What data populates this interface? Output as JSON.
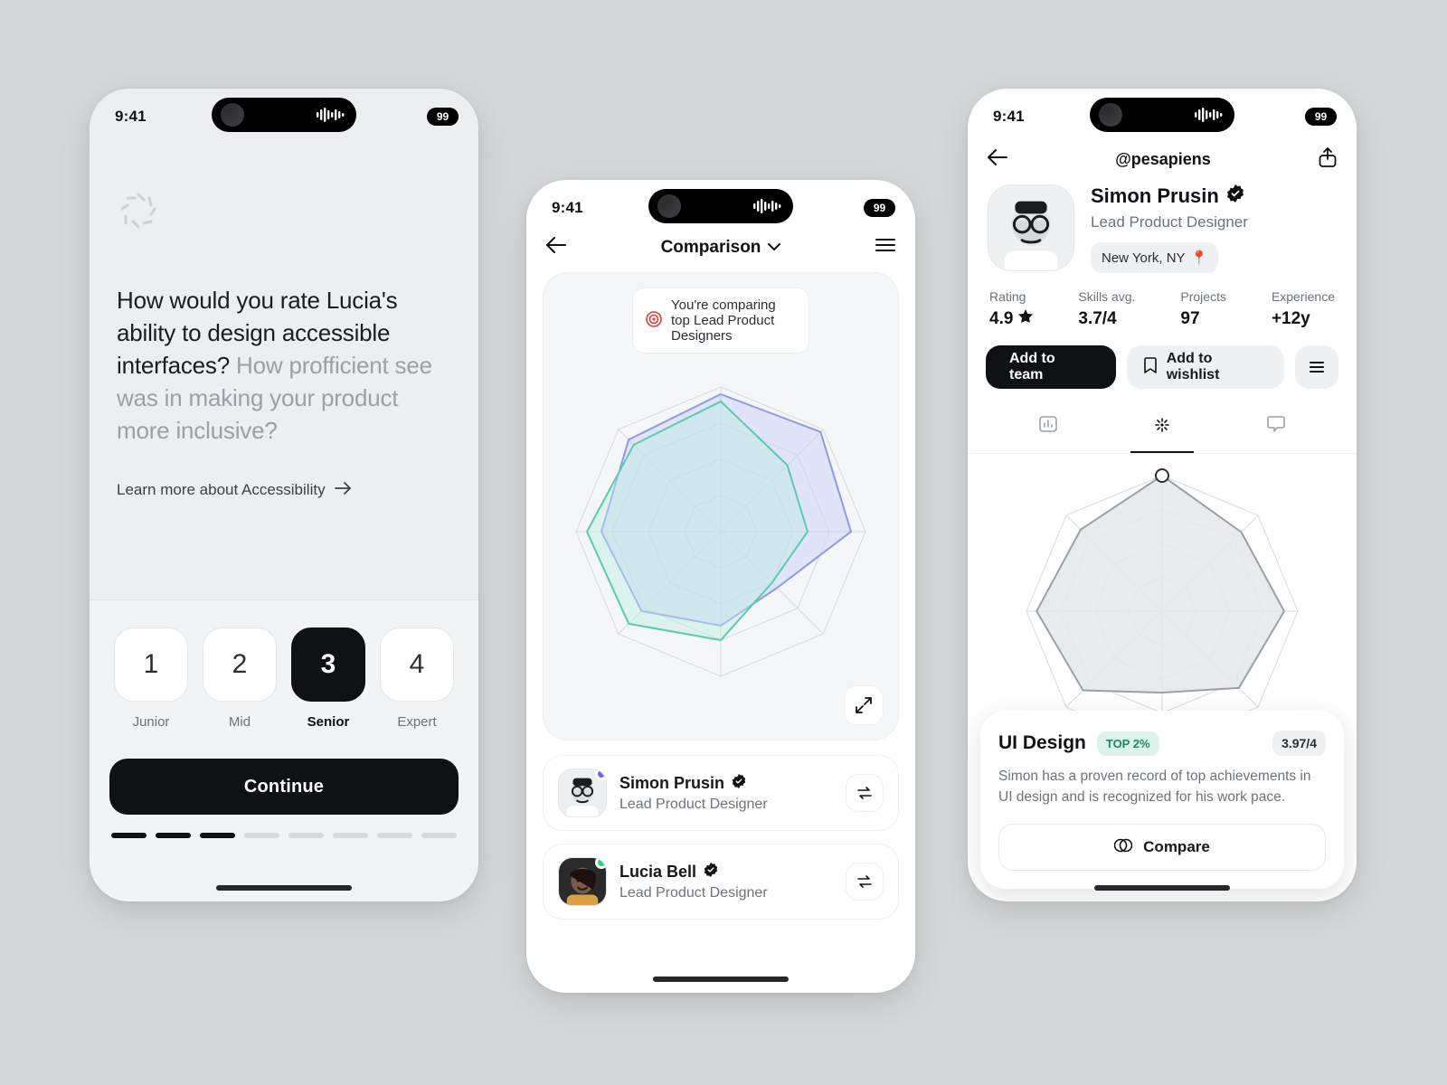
{
  "status": {
    "time": "9:41",
    "battery": "99"
  },
  "phone1": {
    "q_bold": "How would you rate Lucia's ability to design accessible interfaces?",
    "q_faded": " How profficient see was in making your product more inclusive?",
    "learn": "Learn more about Accessibility",
    "ratings": [
      {
        "num": "1",
        "label": "Junior"
      },
      {
        "num": "2",
        "label": "Mid"
      },
      {
        "num": "3",
        "label": "Senior"
      },
      {
        "num": "4",
        "label": "Expert"
      }
    ],
    "active_index": 2,
    "cta": "Continue",
    "progress_total": 8,
    "progress_done": 3
  },
  "phone2": {
    "title": "Comparison",
    "banner": "You're comparing top Lead Product Designers",
    "people": [
      {
        "name": "Simon Prusin",
        "role": "Lead Product Designer",
        "status_color": "#6C63FF"
      },
      {
        "name": "Lucia Bell",
        "role": "Lead Product Designer",
        "status_color": "#2FD27A"
      }
    ]
  },
  "phone3": {
    "handle": "@pesapiens",
    "name": "Simon Prusin",
    "role": "Lead Product Designer",
    "location": "New York, NY",
    "stats": [
      {
        "k": "Rating",
        "v": "4.9"
      },
      {
        "k": "Skills avg.",
        "v": "3.7/4"
      },
      {
        "k": "Projects",
        "v": "97"
      },
      {
        "k": "Experience",
        "v": "+12y"
      }
    ],
    "primary": "Add to team",
    "secondary": "Add to wishlist",
    "skill": {
      "title": "UI Design",
      "top": "TOP 2%",
      "score": "3.97/4",
      "desc": "Simon has a proven record of top achievements in UI design and is recognized for his work pace.",
      "compare": "Compare"
    }
  },
  "chart_data": [
    {
      "type": "radar",
      "id": "comparison_radar",
      "axes_count": 8,
      "range": [
        0,
        4
      ],
      "series": [
        {
          "name": "Simon Prusin",
          "color": "#A9B4F5",
          "values": [
            3.8,
            3.9,
            3.6,
            2.2,
            2.6,
            3.1,
            3.3,
            3.6
          ]
        },
        {
          "name": "Lucia Bell",
          "color": "#8FE0CE",
          "values": [
            3.6,
            2.6,
            2.4,
            2.0,
            3.0,
            3.6,
            3.7,
            3.4
          ]
        }
      ]
    },
    {
      "type": "radar",
      "id": "profile_radar",
      "axes_count": 8,
      "range": [
        0,
        4
      ],
      "highlight_axis": 0,
      "series": [
        {
          "name": "Simon Prusin",
          "color": "#B8BEC2",
          "values": [
            4.0,
            3.3,
            3.6,
            3.2,
            2.4,
            3.3,
            3.7,
            3.4
          ]
        }
      ]
    }
  ]
}
